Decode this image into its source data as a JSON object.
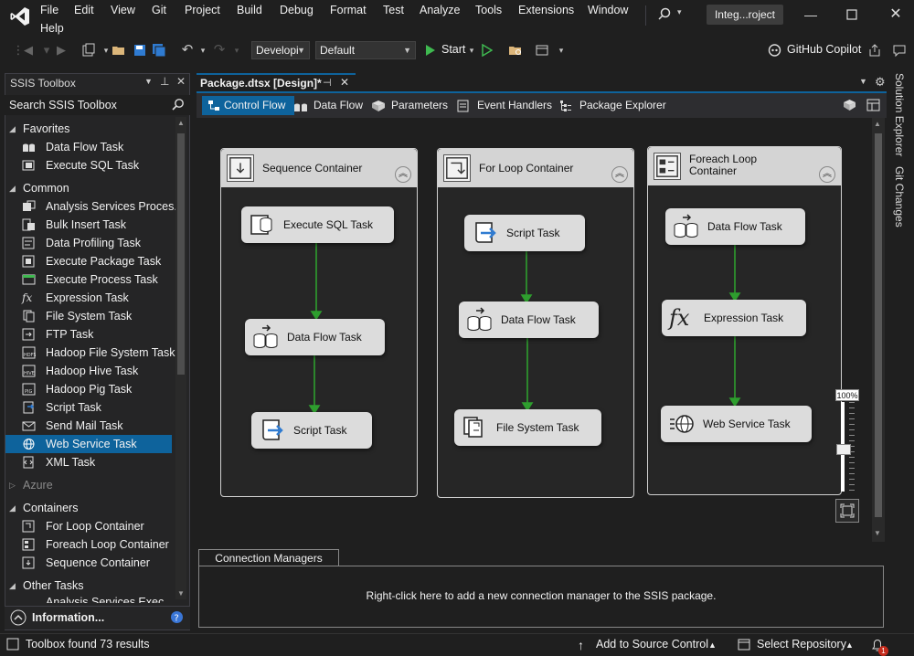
{
  "menu": {
    "items": [
      "File",
      "Edit",
      "View",
      "Git",
      "Project",
      "Build",
      "Debug",
      "Format",
      "Test",
      "Analyze",
      "Tools",
      "Extensions",
      "Window",
      "Help"
    ],
    "title": "Integ...roject"
  },
  "toolbar": {
    "config_combo": "Developi",
    "platform_combo": "Default",
    "start_label": "Start",
    "copilot_label": "GitHub Copilot"
  },
  "toolbox": {
    "title": "SSIS Toolbox",
    "search_placeholder": "Search SSIS Toolbox",
    "categories": {
      "favorites": "Favorites",
      "common": "Common",
      "azure": "Azure",
      "containers": "Containers",
      "other": "Other Tasks"
    },
    "favorites": [
      "Data Flow Task",
      "Execute SQL Task"
    ],
    "common": [
      "Analysis Services Proces...",
      "Bulk Insert Task",
      "Data Profiling Task",
      "Execute Package Task",
      "Execute Process Task",
      "Expression Task",
      "File System Task",
      "FTP Task",
      "Hadoop File System Task",
      "Hadoop Hive Task",
      "Hadoop Pig Task",
      "Script Task",
      "Send Mail Task",
      "Web Service Task",
      "XML Task"
    ],
    "containers": [
      "For Loop Container",
      "Foreach Loop Container",
      "Sequence Container"
    ],
    "other_partial": "Analysis Services Execut...",
    "info_label": "Information..."
  },
  "document": {
    "tab_label": "Package.dtsx [Design]*",
    "designer_tabs": [
      "Control Flow",
      "Data Flow",
      "Parameters",
      "Event Handlers",
      "Package Explorer"
    ]
  },
  "canvas": {
    "containers": [
      {
        "title": "Sequence Container",
        "tasks": [
          "Execute SQL Task",
          "Data Flow Task",
          "Script Task"
        ]
      },
      {
        "title": "For Loop Container",
        "tasks": [
          "Script Task",
          "Data Flow Task",
          "File System Task"
        ]
      },
      {
        "title": "Foreach Loop Container",
        "tasks": [
          "Data Flow Task",
          "Expression Task",
          "Web Service Task"
        ]
      }
    ],
    "zoom": "100%"
  },
  "connection_managers": {
    "tab_label": "Connection Managers",
    "message": "Right-click here to add a new connection manager to the SSIS package."
  },
  "side_panels": [
    "Solution Explorer",
    "Git Changes"
  ],
  "status": {
    "left": "Toolbox found 73 results",
    "source_control": "Add to Source Control",
    "repository": "Select Repository",
    "notification_count": "1"
  },
  "colors": {
    "accent": "#0e639c",
    "connector_green": "#2e9e2e"
  }
}
